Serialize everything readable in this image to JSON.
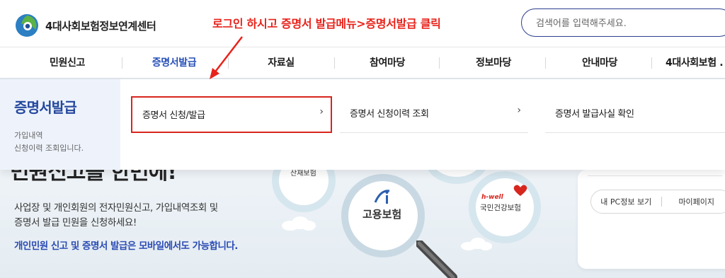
{
  "header": {
    "logo_text": "4대사회보험정보연계센터",
    "annotation": "로그인 하시고 증명서 발급메뉴>증명서발급 클릭",
    "search_placeholder": "검색어를 입력해주세요."
  },
  "gnb": {
    "items": [
      {
        "label": "민원신고"
      },
      {
        "label": "증명서발급"
      },
      {
        "label": "자료실"
      },
      {
        "label": "참여마당"
      },
      {
        "label": "정보마당"
      },
      {
        "label": "안내마당"
      },
      {
        "label": "4대사회보험 ."
      }
    ]
  },
  "mega": {
    "title": "증명서발급",
    "desc_line1": "가입내역",
    "desc_line2": "신청이력 조회입니다.",
    "links": [
      {
        "label": "증명서 신청/발급",
        "chev": "›"
      },
      {
        "label": "증명서 신청이력 조회",
        "chev": "›"
      },
      {
        "label": "증명서 발급사실 확인"
      }
    ]
  },
  "hero": {
    "big_text": "민원신고를 한번에!",
    "line1": "사업장 및 개인회원의 전자민원신고, 가입내역조회 및",
    "line2": "증명서 발급 민원을 신청하세요!",
    "mobile": "개인민원 신고 및 증명서 발급은 모바일에서도 가능합니다.",
    "bubble_left_label": "산재보험",
    "bubble_center_label": "고용보험",
    "bubble_right_brand": "h-well",
    "bubble_right_label": "국민건강보험"
  },
  "card": {
    "btn1": "내 PC정보 보기",
    "btn2": "마이페이지"
  },
  "colors": {
    "accent": "#2850b8",
    "annotation_red": "#e8231b",
    "highlight_border": "#d7261e"
  }
}
